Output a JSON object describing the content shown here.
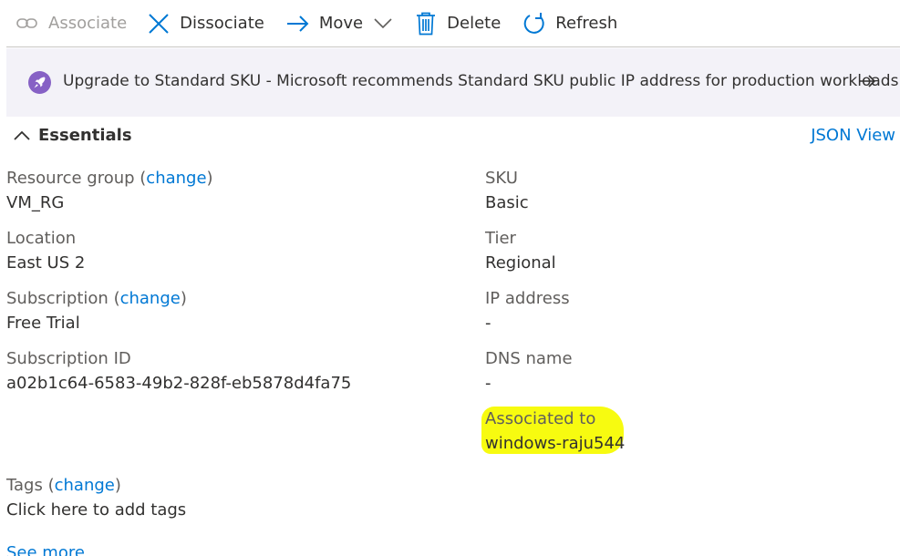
{
  "toolbar": {
    "associate": "Associate",
    "dissociate": "Dissociate",
    "move": "Move",
    "delete": "Delete",
    "refresh": "Refresh"
  },
  "banner": {
    "text": "Upgrade to Standard SKU - Microsoft recommends Standard SKU public IP address for production workloads"
  },
  "essentials": {
    "title": "Essentials",
    "json_view": "JSON View"
  },
  "left": {
    "resource_group": {
      "label": "Resource group",
      "open": " (",
      "change": "change",
      "close": ")",
      "value": "VM_RG"
    },
    "location": {
      "label": "Location",
      "value": "East US 2"
    },
    "subscription": {
      "label": "Subscription",
      "open": " (",
      "change": "change",
      "close": ")",
      "value": "Free Trial"
    },
    "subscription_id": {
      "label": "Subscription ID",
      "value": "a02b1c64-6583-49b2-828f-eb5878d4fa75"
    },
    "tags": {
      "label": "Tags",
      "open": " (",
      "change": "change",
      "close": ")",
      "value": "Click here to add tags"
    },
    "see_more": "See more"
  },
  "right": {
    "sku": {
      "label": "SKU",
      "value": "Basic"
    },
    "tier": {
      "label": "Tier",
      "value": "Regional"
    },
    "ip": {
      "label": "IP address",
      "value": "-"
    },
    "dns": {
      "label": "DNS name",
      "value": "-"
    },
    "associated": {
      "label": "Associated to",
      "value": "windows-raju544"
    }
  },
  "colors": {
    "link": "#0078d4",
    "highlight": "#f6ff00",
    "banner_bg": "#f3f2f8",
    "rocket": "#8661c5"
  }
}
